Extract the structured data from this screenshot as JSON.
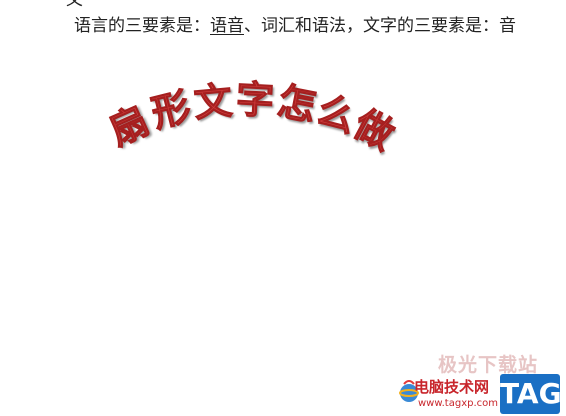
{
  "document": {
    "top_fragment": "义",
    "line1_part1": "语言的三要素是：",
    "line1_underlined": "语音",
    "line1_part2": "、词汇和语法，文字的三要素是：音"
  },
  "wordart": {
    "chars": [
      "扇",
      "形",
      "文",
      "字",
      "怎",
      "么",
      "做"
    ],
    "color": "#cf3c3c"
  },
  "watermark": {
    "top_text": "极光下载站",
    "site_name": "电脑技术网",
    "url": "www.tagxp.com",
    "tag_label": "TAG",
    "tag_color": "#1a6fc4"
  }
}
